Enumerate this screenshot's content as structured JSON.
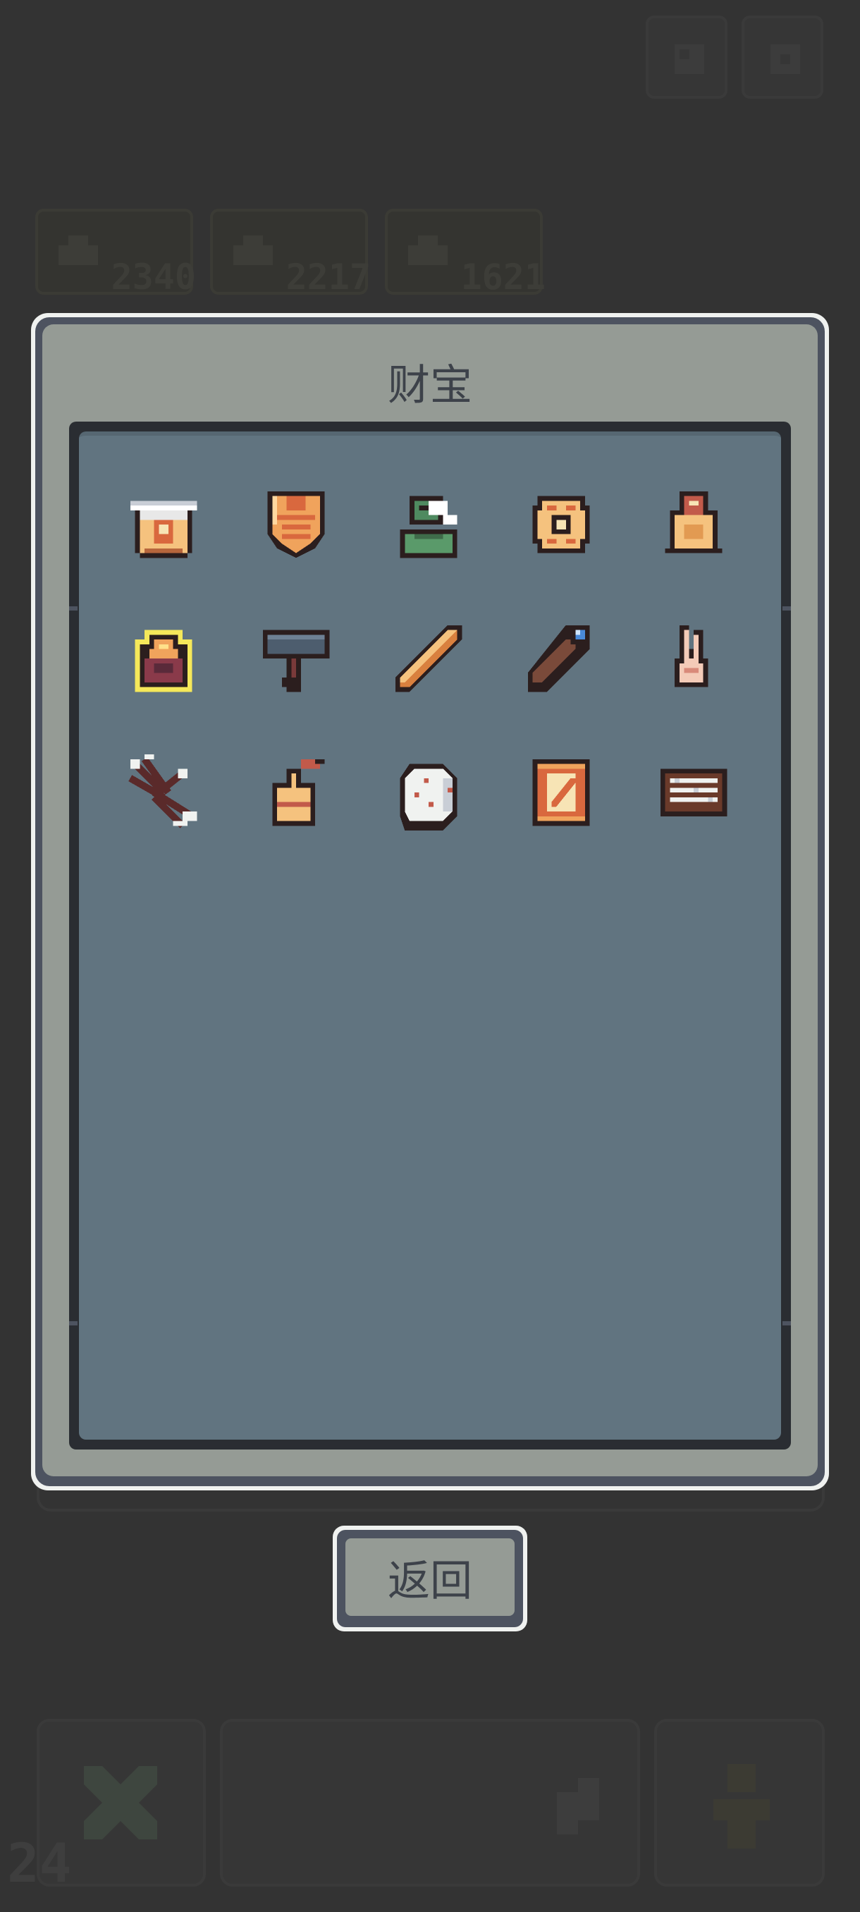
{
  "resources": [
    {
      "icon": "gold-ore-icon",
      "value": "2340"
    },
    {
      "icon": "gold-ore-icon",
      "value": "2217"
    },
    {
      "icon": "gold-ore-icon",
      "value": "1621"
    }
  ],
  "level": "24",
  "modal": {
    "title": "财宝",
    "back_label": "返回"
  },
  "treasures": [
    {
      "icon": "bucket-hat-icon"
    },
    {
      "icon": "chest-armor-icon"
    },
    {
      "icon": "goblin-bust-icon"
    },
    {
      "icon": "ring-icon"
    },
    {
      "icon": "backpack-icon"
    },
    {
      "icon": "lantern-icon",
      "selected": true
    },
    {
      "icon": "hammer-icon"
    },
    {
      "icon": "wooden-stick-icon"
    },
    {
      "icon": "magic-wand-icon"
    },
    {
      "icon": "two-fingers-icon"
    },
    {
      "icon": "arrow-bundle-icon"
    },
    {
      "icon": "gourd-icon"
    },
    {
      "icon": "dice-icon"
    },
    {
      "icon": "scroll-icon"
    },
    {
      "icon": "abacus-icon"
    }
  ],
  "colors": {
    "background": "#333333",
    "panel": "#959b95",
    "inventory": "#617480",
    "frame": "#4d5360",
    "selection": "#f5e85a"
  }
}
